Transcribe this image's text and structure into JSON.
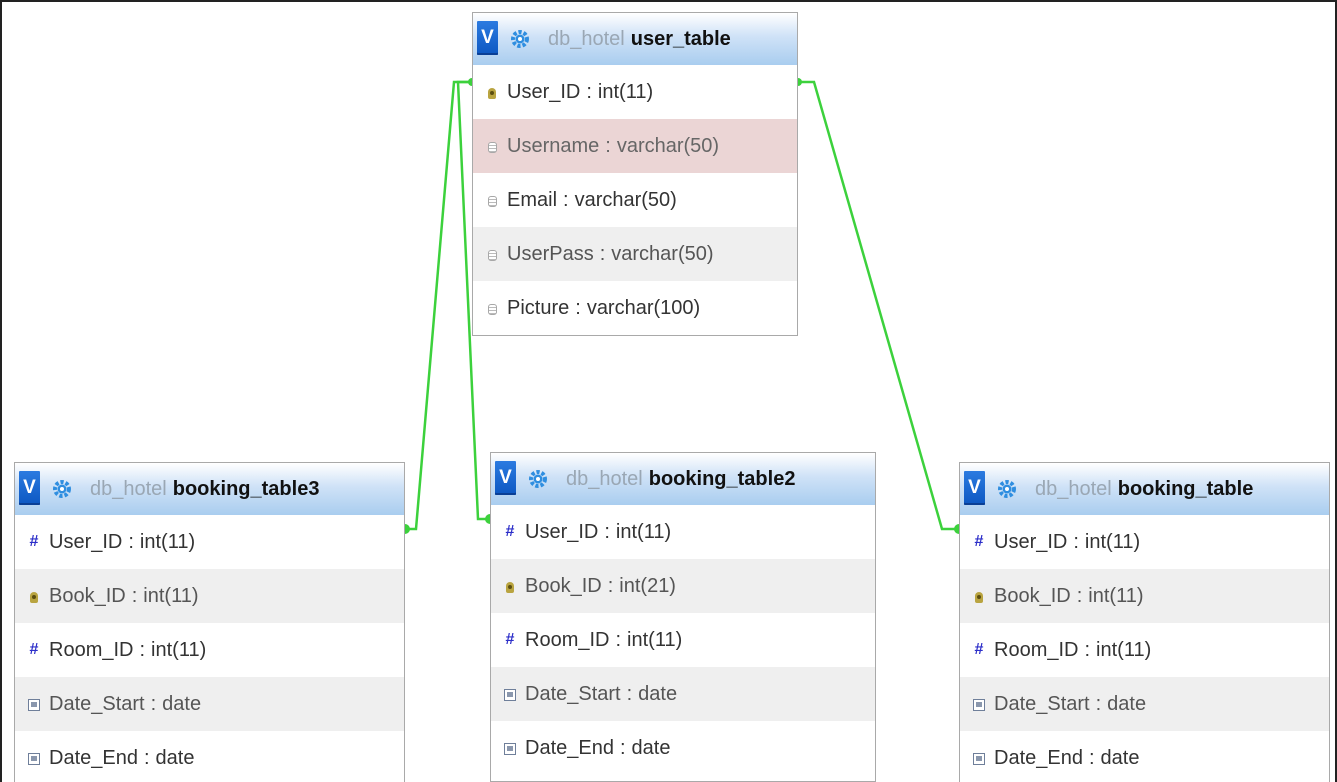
{
  "tables": [
    {
      "id": "user-table",
      "toggle": "V",
      "db": "db_hotel",
      "name": "user_table",
      "columns": [
        {
          "name": "User_ID",
          "type": "int(11)",
          "icon": "primary-key-icon"
        },
        {
          "name": "Username",
          "type": "varchar(50)",
          "icon": "text-column-icon"
        },
        {
          "name": "Email",
          "type": "varchar(50)",
          "icon": "text-column-icon"
        },
        {
          "name": "UserPass",
          "type": "varchar(50)",
          "icon": "text-column-icon"
        },
        {
          "name": "Picture",
          "type": "varchar(100)",
          "icon": "text-column-icon"
        }
      ]
    },
    {
      "id": "booking-table3",
      "toggle": "V",
      "db": "db_hotel",
      "name": "booking_table3",
      "columns": [
        {
          "name": "User_ID",
          "type": "int(11)",
          "icon": "numeric-column-icon"
        },
        {
          "name": "Book_ID",
          "type": "int(11)",
          "icon": "primary-key-icon"
        },
        {
          "name": "Room_ID",
          "type": "int(11)",
          "icon": "numeric-column-icon"
        },
        {
          "name": "Date_Start",
          "type": "date",
          "icon": "date-column-icon"
        },
        {
          "name": "Date_End",
          "type": "date",
          "icon": "date-column-icon"
        }
      ]
    },
    {
      "id": "booking-table2",
      "toggle": "V",
      "db": "db_hotel",
      "name": "booking_table2",
      "columns": [
        {
          "name": "User_ID",
          "type": "int(11)",
          "icon": "numeric-column-icon"
        },
        {
          "name": "Book_ID",
          "type": "int(21)",
          "icon": "primary-key-icon"
        },
        {
          "name": "Room_ID",
          "type": "int(11)",
          "icon": "numeric-column-icon"
        },
        {
          "name": "Date_Start",
          "type": "date",
          "icon": "date-column-icon"
        },
        {
          "name": "Date_End",
          "type": "date",
          "icon": "date-column-icon"
        }
      ]
    },
    {
      "id": "booking-table",
      "toggle": "V",
      "db": "db_hotel",
      "name": "booking_table",
      "columns": [
        {
          "name": "User_ID",
          "type": "int(11)",
          "icon": "numeric-column-icon"
        },
        {
          "name": "Book_ID",
          "type": "int(11)",
          "icon": "primary-key-icon"
        },
        {
          "name": "Room_ID",
          "type": "int(11)",
          "icon": "numeric-column-icon"
        },
        {
          "name": "Date_Start",
          "type": "date",
          "icon": "date-column-icon"
        },
        {
          "name": "Date_End",
          "type": "date",
          "icon": "date-column-icon"
        }
      ]
    }
  ],
  "colors": {
    "relation_line": "#3cd13c",
    "header_gradient_bottom": "#a9cdef",
    "toggle_button": "#1a66d4",
    "highlight_row": "#ebd5d5",
    "alt_row": "#efefef"
  }
}
